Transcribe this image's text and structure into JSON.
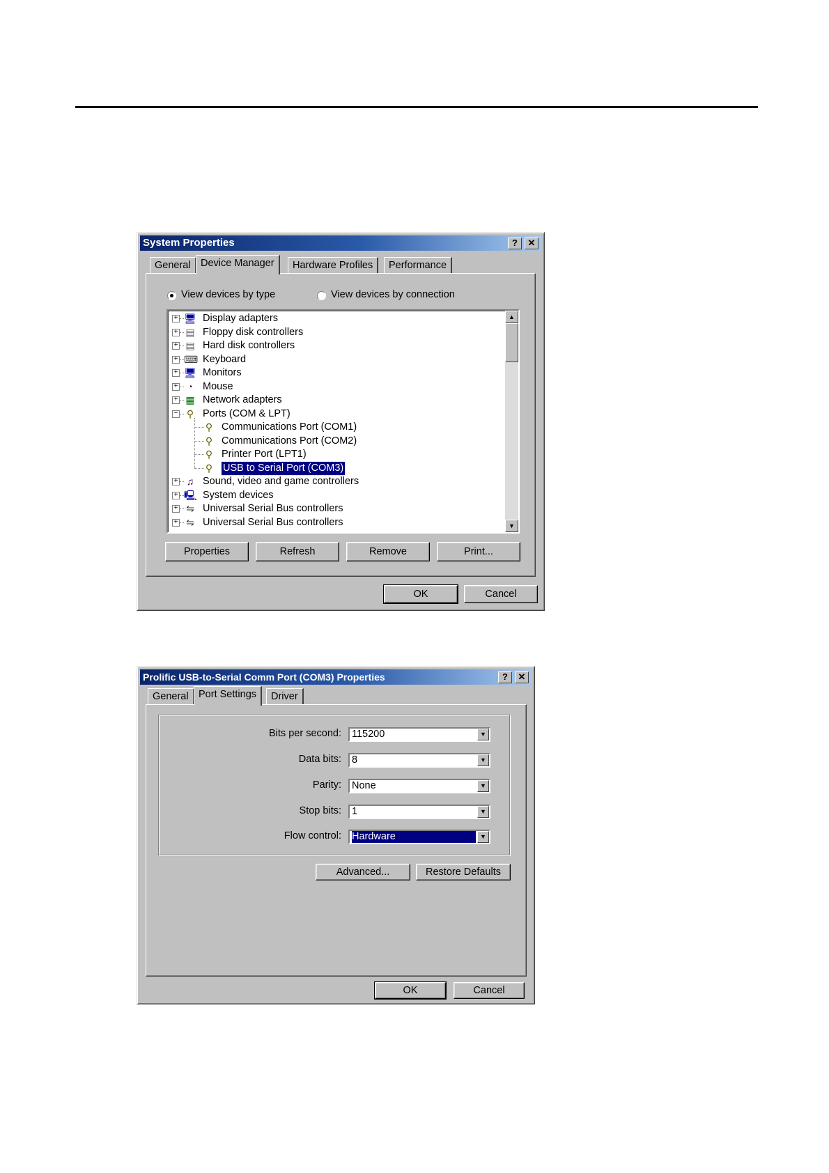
{
  "system_properties": {
    "title": "System Properties",
    "help_btn": "?",
    "close_btn": "✕",
    "tabs": [
      "General",
      "Device Manager",
      "Hardware Profiles",
      "Performance"
    ],
    "active_tab": "Device Manager",
    "radio_by_type": "View devices by type",
    "radio_by_connection": "View devices by connection",
    "radio_selected": "View devices by type",
    "tree": [
      {
        "label": "Display adapters",
        "icon": "monitor-icon"
      },
      {
        "label": "Floppy disk controllers",
        "icon": "disk-controller-icon"
      },
      {
        "label": "Hard disk controllers",
        "icon": "disk-controller-icon"
      },
      {
        "label": "Keyboard",
        "icon": "keyboard-icon"
      },
      {
        "label": "Monitors",
        "icon": "monitor-icon"
      },
      {
        "label": "Mouse",
        "icon": "mouse-icon"
      },
      {
        "label": "Network adapters",
        "icon": "network-adapter-icon"
      },
      {
        "label": "Ports (COM & LPT)",
        "icon": "port-icon",
        "expanded": true
      },
      {
        "label": "Communications Port (COM1)",
        "icon": "port-icon",
        "child": true
      },
      {
        "label": "Communications Port (COM2)",
        "icon": "port-icon",
        "child": true
      },
      {
        "label": "Printer Port (LPT1)",
        "icon": "port-icon",
        "child": true
      },
      {
        "label": "USB to Serial Port (COM3)",
        "icon": "port-icon",
        "child": true,
        "selected": true
      },
      {
        "label": "Sound, video and game controllers",
        "icon": "sound-icon"
      },
      {
        "label": "System devices",
        "icon": "computer-icon"
      },
      {
        "label": "Universal Serial Bus controllers",
        "icon": "usb-icon"
      },
      {
        "label": "Universal Serial Bus controllers",
        "icon": "usb-icon"
      }
    ],
    "buttons": {
      "properties": "Properties",
      "refresh": "Refresh",
      "remove": "Remove",
      "print": "Print...",
      "ok": "OK",
      "cancel": "Cancel"
    }
  },
  "port_properties": {
    "title": "Prolific USB-to-Serial Comm Port (COM3) Properties",
    "help_btn": "?",
    "close_btn": "✕",
    "tabs": [
      "General",
      "Port Settings",
      "Driver"
    ],
    "active_tab": "Port Settings",
    "fields": {
      "bits_per_second": {
        "label": "Bits per second:",
        "value": "115200"
      },
      "data_bits": {
        "label": "Data bits:",
        "value": "8"
      },
      "parity": {
        "label": "Parity:",
        "value": "None"
      },
      "stop_bits": {
        "label": "Stop bits:",
        "value": "1"
      },
      "flow_control": {
        "label": "Flow control:",
        "value": "Hardware"
      }
    },
    "buttons": {
      "advanced": "Advanced...",
      "restore_defaults": "Restore Defaults",
      "ok": "OK",
      "cancel": "Cancel"
    }
  },
  "colors": {
    "title_start": "#0a246a",
    "title_end": "#a6caf0",
    "face": "#c0c0c0",
    "selection": "#000080"
  }
}
